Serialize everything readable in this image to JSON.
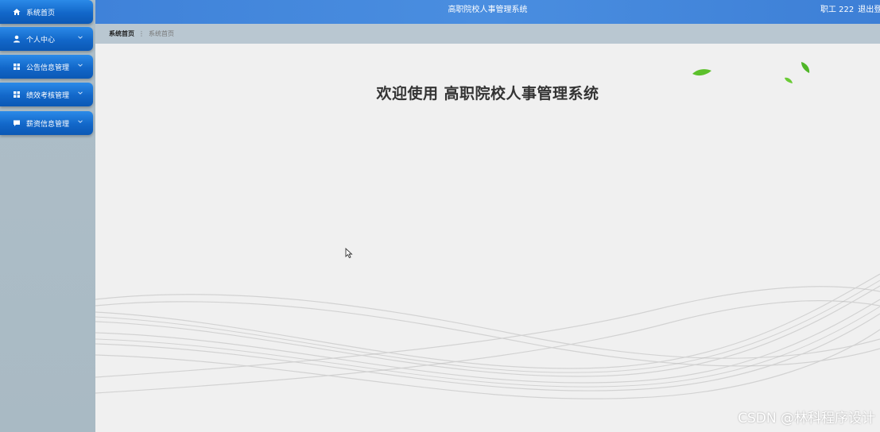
{
  "header": {
    "title": "高职院校人事管理系统",
    "user_label": "职工 222",
    "logout_label": "退出登"
  },
  "sidebar": {
    "items": [
      {
        "label": "系统首页",
        "icon": "home-icon",
        "has_submenu": false
      },
      {
        "label": "个人中心",
        "icon": "user-icon",
        "has_submenu": true
      },
      {
        "label": "公告信息管理",
        "icon": "grid-icon",
        "has_submenu": true
      },
      {
        "label": "绩效考核管理",
        "icon": "grid-icon",
        "has_submenu": true
      },
      {
        "label": "薪资信息管理",
        "icon": "chat-icon",
        "has_submenu": true
      }
    ]
  },
  "breadcrumb": {
    "home": "系统首页",
    "current": "系统首页"
  },
  "main": {
    "welcome": "欢迎使用 高职院校人事管理系统"
  },
  "watermark": "CSDN @林科程序设计",
  "colors": {
    "menu_blue": "#1267c9",
    "header_blue": "#4a8ee0",
    "leaf_green": "#58c02a"
  }
}
